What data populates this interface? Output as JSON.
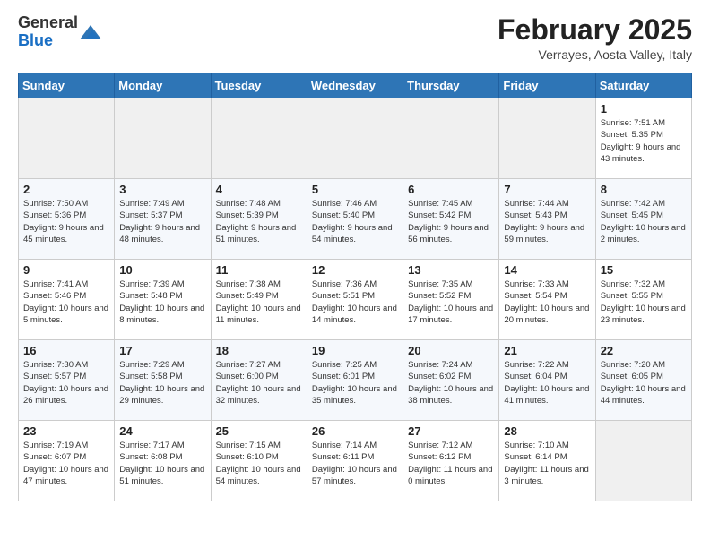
{
  "logo": {
    "general": "General",
    "blue": "Blue"
  },
  "header": {
    "month": "February 2025",
    "location": "Verrayes, Aosta Valley, Italy"
  },
  "weekdays": [
    "Sunday",
    "Monday",
    "Tuesday",
    "Wednesday",
    "Thursday",
    "Friday",
    "Saturday"
  ],
  "weeks": [
    [
      {
        "day": "",
        "info": ""
      },
      {
        "day": "",
        "info": ""
      },
      {
        "day": "",
        "info": ""
      },
      {
        "day": "",
        "info": ""
      },
      {
        "day": "",
        "info": ""
      },
      {
        "day": "",
        "info": ""
      },
      {
        "day": "1",
        "info": "Sunrise: 7:51 AM\nSunset: 5:35 PM\nDaylight: 9 hours and 43 minutes."
      }
    ],
    [
      {
        "day": "2",
        "info": "Sunrise: 7:50 AM\nSunset: 5:36 PM\nDaylight: 9 hours and 45 minutes."
      },
      {
        "day": "3",
        "info": "Sunrise: 7:49 AM\nSunset: 5:37 PM\nDaylight: 9 hours and 48 minutes."
      },
      {
        "day": "4",
        "info": "Sunrise: 7:48 AM\nSunset: 5:39 PM\nDaylight: 9 hours and 51 minutes."
      },
      {
        "day": "5",
        "info": "Sunrise: 7:46 AM\nSunset: 5:40 PM\nDaylight: 9 hours and 54 minutes."
      },
      {
        "day": "6",
        "info": "Sunrise: 7:45 AM\nSunset: 5:42 PM\nDaylight: 9 hours and 56 minutes."
      },
      {
        "day": "7",
        "info": "Sunrise: 7:44 AM\nSunset: 5:43 PM\nDaylight: 9 hours and 59 minutes."
      },
      {
        "day": "8",
        "info": "Sunrise: 7:42 AM\nSunset: 5:45 PM\nDaylight: 10 hours and 2 minutes."
      }
    ],
    [
      {
        "day": "9",
        "info": "Sunrise: 7:41 AM\nSunset: 5:46 PM\nDaylight: 10 hours and 5 minutes."
      },
      {
        "day": "10",
        "info": "Sunrise: 7:39 AM\nSunset: 5:48 PM\nDaylight: 10 hours and 8 minutes."
      },
      {
        "day": "11",
        "info": "Sunrise: 7:38 AM\nSunset: 5:49 PM\nDaylight: 10 hours and 11 minutes."
      },
      {
        "day": "12",
        "info": "Sunrise: 7:36 AM\nSunset: 5:51 PM\nDaylight: 10 hours and 14 minutes."
      },
      {
        "day": "13",
        "info": "Sunrise: 7:35 AM\nSunset: 5:52 PM\nDaylight: 10 hours and 17 minutes."
      },
      {
        "day": "14",
        "info": "Sunrise: 7:33 AM\nSunset: 5:54 PM\nDaylight: 10 hours and 20 minutes."
      },
      {
        "day": "15",
        "info": "Sunrise: 7:32 AM\nSunset: 5:55 PM\nDaylight: 10 hours and 23 minutes."
      }
    ],
    [
      {
        "day": "16",
        "info": "Sunrise: 7:30 AM\nSunset: 5:57 PM\nDaylight: 10 hours and 26 minutes."
      },
      {
        "day": "17",
        "info": "Sunrise: 7:29 AM\nSunset: 5:58 PM\nDaylight: 10 hours and 29 minutes."
      },
      {
        "day": "18",
        "info": "Sunrise: 7:27 AM\nSunset: 6:00 PM\nDaylight: 10 hours and 32 minutes."
      },
      {
        "day": "19",
        "info": "Sunrise: 7:25 AM\nSunset: 6:01 PM\nDaylight: 10 hours and 35 minutes."
      },
      {
        "day": "20",
        "info": "Sunrise: 7:24 AM\nSunset: 6:02 PM\nDaylight: 10 hours and 38 minutes."
      },
      {
        "day": "21",
        "info": "Sunrise: 7:22 AM\nSunset: 6:04 PM\nDaylight: 10 hours and 41 minutes."
      },
      {
        "day": "22",
        "info": "Sunrise: 7:20 AM\nSunset: 6:05 PM\nDaylight: 10 hours and 44 minutes."
      }
    ],
    [
      {
        "day": "23",
        "info": "Sunrise: 7:19 AM\nSunset: 6:07 PM\nDaylight: 10 hours and 47 minutes."
      },
      {
        "day": "24",
        "info": "Sunrise: 7:17 AM\nSunset: 6:08 PM\nDaylight: 10 hours and 51 minutes."
      },
      {
        "day": "25",
        "info": "Sunrise: 7:15 AM\nSunset: 6:10 PM\nDaylight: 10 hours and 54 minutes."
      },
      {
        "day": "26",
        "info": "Sunrise: 7:14 AM\nSunset: 6:11 PM\nDaylight: 10 hours and 57 minutes."
      },
      {
        "day": "27",
        "info": "Sunrise: 7:12 AM\nSunset: 6:12 PM\nDaylight: 11 hours and 0 minutes."
      },
      {
        "day": "28",
        "info": "Sunrise: 7:10 AM\nSunset: 6:14 PM\nDaylight: 11 hours and 3 minutes."
      },
      {
        "day": "",
        "info": ""
      }
    ]
  ]
}
